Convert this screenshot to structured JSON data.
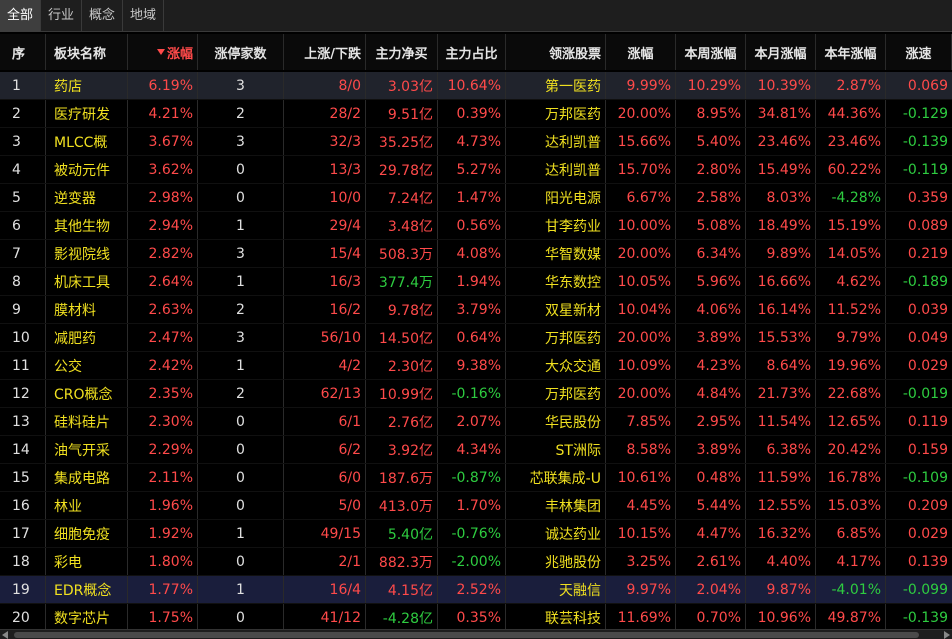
{
  "tabs": [
    "全部",
    "行业",
    "概念",
    "地域"
  ],
  "active_tab": 0,
  "headers": [
    "序",
    "板块名称",
    "涨幅",
    "涨停家数",
    "上涨/下跌",
    "主力净买",
    "主力占比",
    "领涨股票",
    "涨幅",
    "本周涨幅",
    "本月涨幅",
    "本年涨幅",
    "涨速"
  ],
  "colors": {
    "up": "#ff4a4a",
    "down": "#2ecc40",
    "name": "#f0e020"
  },
  "rows": [
    [
      "1",
      "药店",
      "6.19%",
      "3",
      "8/0",
      "3.03亿",
      "10.64%",
      "第一医药",
      "9.99%",
      "10.29%",
      "10.39%",
      "2.87%",
      "0.069"
    ],
    [
      "2",
      "医疗研发",
      "4.21%",
      "2",
      "28/2",
      "9.51亿",
      "0.39%",
      "万邦医药",
      "20.00%",
      "8.95%",
      "34.81%",
      "44.36%",
      "-0.129"
    ],
    [
      "3",
      "MLCC概",
      "3.67%",
      "3",
      "32/3",
      "35.25亿",
      "4.73%",
      "达利凯普",
      "15.66%",
      "5.40%",
      "23.46%",
      "23.46%",
      "-0.139"
    ],
    [
      "4",
      "被动元件",
      "3.62%",
      "0",
      "13/3",
      "29.78亿",
      "5.27%",
      "达利凯普",
      "15.70%",
      "2.80%",
      "15.49%",
      "60.22%",
      "-0.119"
    ],
    [
      "5",
      "逆变器",
      "2.98%",
      "0",
      "10/0",
      "7.24亿",
      "1.47%",
      "阳光电源",
      "6.67%",
      "2.58%",
      "8.03%",
      "-4.28%",
      "0.359"
    ],
    [
      "6",
      "其他生物",
      "2.94%",
      "1",
      "29/4",
      "3.48亿",
      "0.56%",
      "甘李药业",
      "10.00%",
      "5.08%",
      "18.49%",
      "15.19%",
      "0.089"
    ],
    [
      "7",
      "影视院线",
      "2.82%",
      "3",
      "15/4",
      "508.3万",
      "4.08%",
      "华智数媒",
      "20.00%",
      "6.34%",
      "9.89%",
      "14.05%",
      "0.219"
    ],
    [
      "8",
      "机床工具",
      "2.64%",
      "1",
      "16/3",
      "377.4万",
      "1.94%",
      "华东数控",
      "10.05%",
      "5.96%",
      "16.66%",
      "4.62%",
      "-0.189"
    ],
    [
      "9",
      "膜材料",
      "2.63%",
      "2",
      "16/2",
      "9.78亿",
      "3.79%",
      "双星新材",
      "10.04%",
      "4.06%",
      "16.14%",
      "11.52%",
      "0.039"
    ],
    [
      "10",
      "减肥药",
      "2.47%",
      "3",
      "56/10",
      "14.50亿",
      "0.64%",
      "万邦医药",
      "20.00%",
      "3.89%",
      "15.53%",
      "9.79%",
      "0.049"
    ],
    [
      "11",
      "公交",
      "2.42%",
      "1",
      "4/2",
      "2.30亿",
      "9.38%",
      "大众交通",
      "10.09%",
      "4.23%",
      "8.64%",
      "19.96%",
      "0.029"
    ],
    [
      "12",
      "CRO概念",
      "2.35%",
      "2",
      "62/13",
      "10.99亿",
      "-0.16%",
      "万邦医药",
      "20.00%",
      "4.84%",
      "21.73%",
      "22.68%",
      "-0.019"
    ],
    [
      "13",
      "硅料硅片",
      "2.30%",
      "0",
      "6/1",
      "2.76亿",
      "2.07%",
      "华民股份",
      "7.85%",
      "2.95%",
      "11.54%",
      "12.65%",
      "0.119"
    ],
    [
      "14",
      "油气开采",
      "2.29%",
      "0",
      "6/2",
      "3.92亿",
      "4.34%",
      "ST洲际",
      "8.58%",
      "3.89%",
      "6.38%",
      "20.42%",
      "0.159"
    ],
    [
      "15",
      "集成电路",
      "2.11%",
      "0",
      "6/0",
      "187.6万",
      "-0.87%",
      "芯联集成-U",
      "10.61%",
      "0.48%",
      "11.59%",
      "16.78%",
      "-0.109"
    ],
    [
      "16",
      "林业",
      "1.96%",
      "0",
      "5/0",
      "413.0万",
      "1.70%",
      "丰林集团",
      "4.45%",
      "5.44%",
      "12.55%",
      "15.03%",
      "0.209"
    ],
    [
      "17",
      "细胞免疫",
      "1.92%",
      "1",
      "49/15",
      "5.40亿",
      "-0.76%",
      "诚达药业",
      "10.15%",
      "4.47%",
      "16.32%",
      "6.85%",
      "0.029"
    ],
    [
      "18",
      "彩电",
      "1.80%",
      "0",
      "2/1",
      "882.3万",
      "-2.00%",
      "兆驰股份",
      "3.25%",
      "2.61%",
      "4.40%",
      "4.17%",
      "0.139"
    ],
    [
      "19",
      "EDR概念",
      "1.77%",
      "1",
      "16/4",
      "4.15亿",
      "2.52%",
      "天融信",
      "9.97%",
      "2.04%",
      "9.87%",
      "-4.01%",
      "-0.099"
    ],
    [
      "20",
      "数字芯片",
      "1.75%",
      "0",
      "41/12",
      "-4.28亿",
      "0.35%",
      "联芸科技",
      "11.69%",
      "0.70%",
      "10.96%",
      "49.87%",
      "-0.139"
    ]
  ],
  "green_net_buy_rows": [
    7,
    16
  ]
}
